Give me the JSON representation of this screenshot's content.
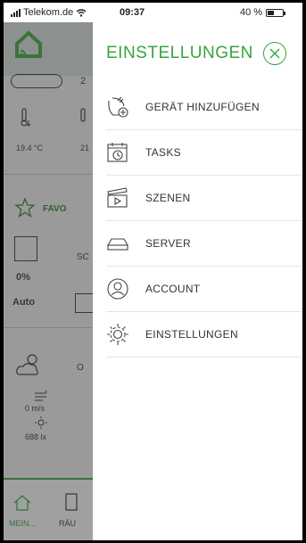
{
  "status_bar": {
    "carrier": "Telekom.de",
    "time": "09:37",
    "battery": "40 %"
  },
  "background": {
    "temp1": "19.4 °C",
    "temp2": "21",
    "favorites_partial": "FAVO",
    "percent": "0%",
    "mode": "Auto",
    "partial_sc": "SC",
    "partial_o": "O",
    "partial_z": "2",
    "wind": "0 m/s",
    "light": "688 lx",
    "tab_home": "MEIN...",
    "tab_rooms": "RÄU"
  },
  "drawer": {
    "title": "EINSTELLUNGEN",
    "items": [
      {
        "label": "GERÄT HINZUFÜGEN",
        "icon": "add-device-icon"
      },
      {
        "label": "TASKS",
        "icon": "calendar-clock-icon"
      },
      {
        "label": "SZENEN",
        "icon": "clapperboard-icon"
      },
      {
        "label": "SERVER",
        "icon": "server-icon"
      },
      {
        "label": "ACCOUNT",
        "icon": "user-icon"
      },
      {
        "label": "EINSTELLUNGEN",
        "icon": "gear-icon"
      }
    ]
  },
  "colors": {
    "accent": "#35a53f",
    "text": "#333333",
    "divider": "#e6e6e6"
  }
}
